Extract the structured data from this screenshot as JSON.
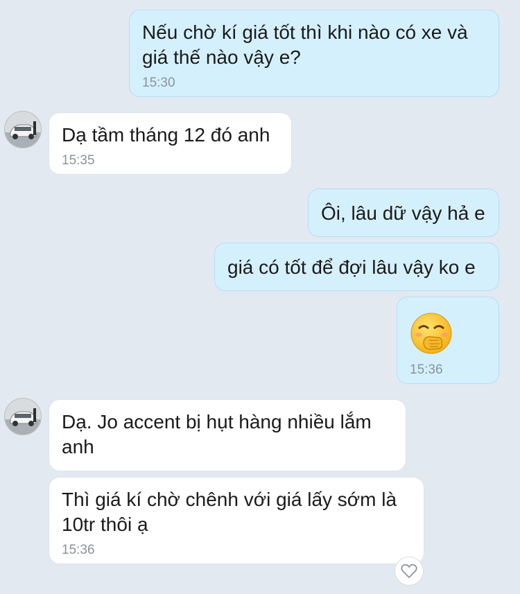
{
  "colors": {
    "background": "#e2e9f1",
    "outgoing_bubble": "#d5f0fd",
    "incoming_bubble": "#ffffff",
    "timestamp": "#8a929b"
  },
  "messages": [
    {
      "sender": "me",
      "text": "Nếu chờ kí giá tốt thì khi nào có xe và giá thế nào vậy e?",
      "time": "15:30"
    },
    {
      "sender": "them",
      "text": "Dạ tầm tháng 12 đó anh",
      "time": "15:35",
      "avatar": "car-photo-avatar"
    },
    {
      "sender": "me",
      "text": "Ôi, lâu dữ vậy hả e",
      "time": ""
    },
    {
      "sender": "me",
      "text": "giá có tốt để đợi lâu vậy ko e",
      "time": ""
    },
    {
      "sender": "me",
      "text": "",
      "time": "15:36",
      "sticker": "grinning-hand-over-mouth-emoji"
    },
    {
      "sender": "them",
      "text": "Dạ. Jo accent bị hụt hàng nhiều lắm anh",
      "time": "",
      "avatar": "car-photo-avatar"
    },
    {
      "sender": "them",
      "text": "Thì giá kí chờ chênh với giá lấy sớm là 10tr thôi ạ",
      "time": "15:36"
    }
  ],
  "reaction": {
    "icon": "heart-outline-icon"
  }
}
